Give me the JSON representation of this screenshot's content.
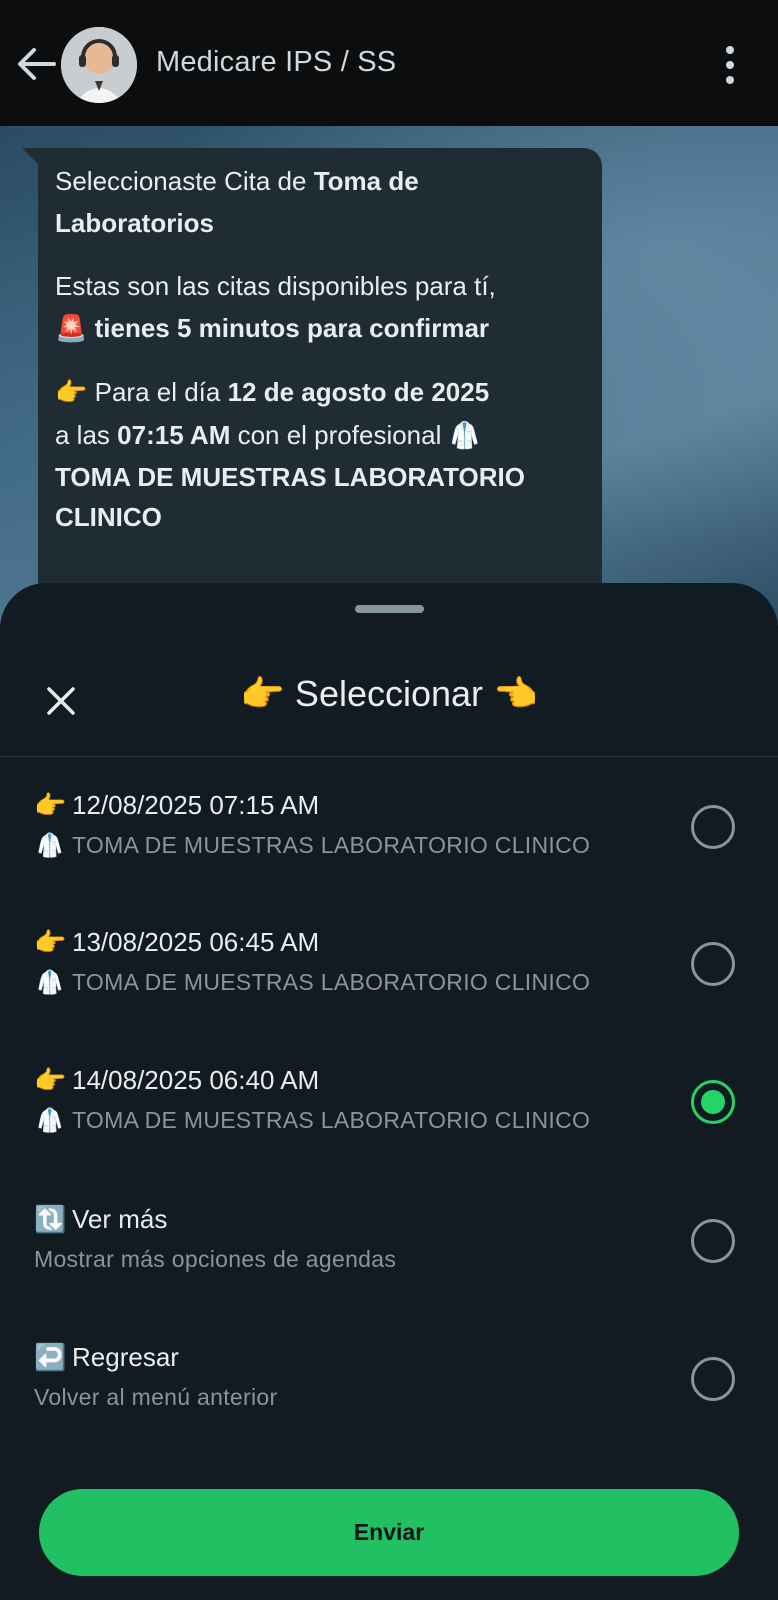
{
  "header": {
    "contact_name": "Medicare IPS / SS",
    "back_icon": "arrow-left-icon",
    "menu_icon": "more-vertical-icon"
  },
  "message": {
    "line1_pre": "Seleccionaste Cita de ",
    "line1_bold": "Toma de Laboratorios",
    "line2": "Estas son las citas disponibles para tí,",
    "alert_icon": "🚨",
    "line3_bold": "tienes 5 minutos para confirmar",
    "pointer_icon": "👉",
    "line4_pre": "Para el día ",
    "line4_bold": "12 de agosto de 2025",
    "line5_pre": "a las ",
    "line5_bold": "07:15 AM",
    "line5_post": " con el profesional ",
    "doctor_icon": "🥼",
    "line6_bold": "TOMA DE MUESTRAS LABORATORIO CLINICO"
  },
  "sheet": {
    "title": "👉 Seleccionar 👈",
    "close_icon": "close-icon",
    "options": [
      {
        "icon": "👉",
        "title": "12/08/2025 07:15 AM",
        "sub_icon": "🥼",
        "subtitle": "TOMA DE MUESTRAS LABORATORIO CLINICO",
        "selected": false
      },
      {
        "icon": "👉",
        "title": "13/08/2025 06:45 AM",
        "sub_icon": "🥼",
        "subtitle": "TOMA DE MUESTRAS LABORATORIO CLINICO",
        "selected": false
      },
      {
        "icon": "👉",
        "title": "14/08/2025 06:40 AM",
        "sub_icon": "🥼",
        "subtitle": "TOMA DE MUESTRAS LABORATORIO CLINICO",
        "selected": true
      },
      {
        "icon": "🔃",
        "title": "Ver más",
        "subtitle": "Mostrar más opciones de agendas",
        "selected": false
      },
      {
        "icon": "↩️",
        "title": "Regresar",
        "subtitle": "Volver al menú anterior",
        "selected": false
      }
    ],
    "send_label": "Enviar"
  },
  "colors": {
    "accent": "#25d366",
    "sheet_bg": "#111b21",
    "bubble_bg": "#1f2c33",
    "header_bg": "#0b0d0f"
  }
}
